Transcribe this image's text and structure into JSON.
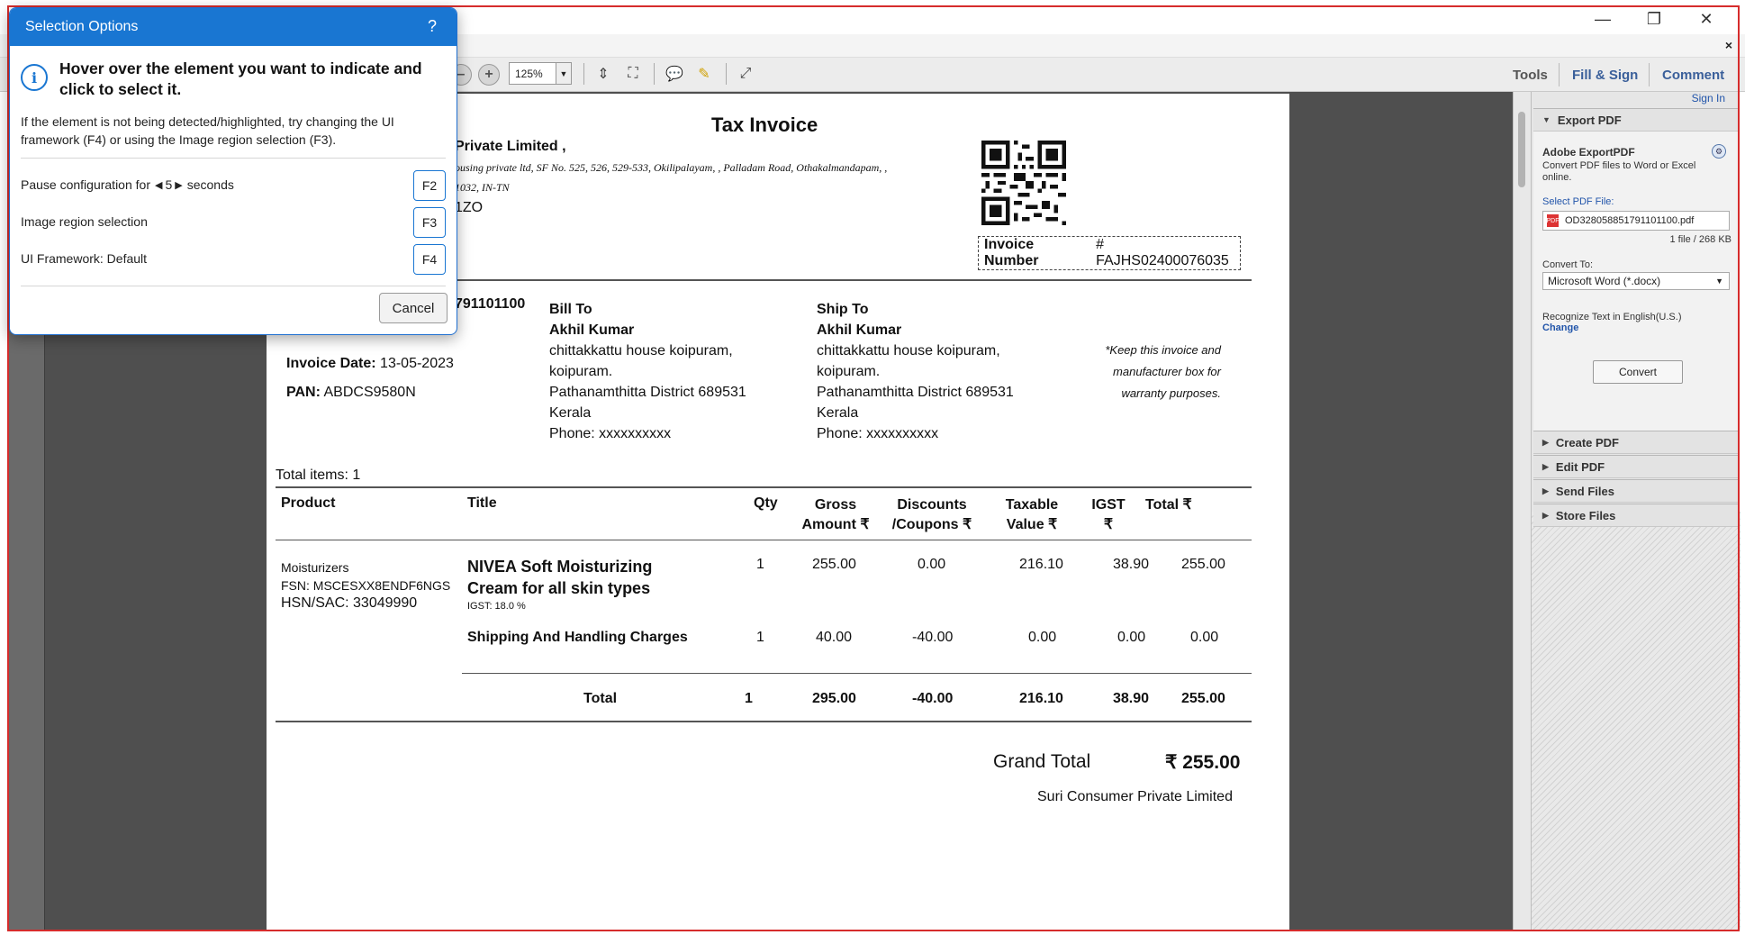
{
  "window": {
    "minimize_glyph": "—",
    "maximize_glyph": "❐",
    "close_glyph": "✕",
    "close_doc_glyph": "×"
  },
  "toolbar": {
    "zoom_value": "125%",
    "tools_label": "Tools",
    "fill_sign_label": "Fill & Sign",
    "comment_label": "Comment"
  },
  "dialog": {
    "title": "Selection Options",
    "help": "?",
    "heading": "Hover over the element you want to indicate and click to select it.",
    "subtext": "If the element is not being detected/highlighted, try changing the UI framework (F4) or using the Image region selection (F3).",
    "pause_prefix": "Pause configuration for",
    "pause_value": "5",
    "pause_suffix": "seconds",
    "pause_key": "F2",
    "image_region_label": "Image region selection",
    "image_region_key": "F3",
    "ui_framework_label": "UI Framework: Default",
    "ui_framework_key": "F4",
    "cancel_label": "Cancel"
  },
  "invoice": {
    "title": "Tax Invoice",
    "seller_name": "Private Limited ,",
    "seller_addr_1": "ousing private ltd, SF No. 525, 526, 529-533, Okilipalayam, , Palladam Road, Othakalmandapam, ,",
    "seller_addr_2": "1032, IN-TN",
    "seller_code": "1ZO",
    "order_id_partial": "791101100",
    "invoice_number_label": "Invoice Number",
    "invoice_number_value": "# FAJHS02400076035",
    "invoice_date_label": "Invoice Date:",
    "invoice_date_value": "13-05-2023",
    "pan_label": "PAN:",
    "pan_value": "ABDCS9580N",
    "bill_to": {
      "heading": "Bill To",
      "name": "Akhil Kumar",
      "line1": "chittakkattu house koipuram,",
      "line2": "koipuram.",
      "line3": "Pathanamthitta District 689531",
      "line4": "Kerala",
      "phone": "Phone: xxxxxxxxxx"
    },
    "ship_to": {
      "heading": "Ship To",
      "name": "Akhil Kumar",
      "line1": "chittakkattu house koipuram,",
      "line2": "koipuram.",
      "line3": "Pathanamthitta District 689531",
      "line4": "Kerala",
      "phone": "Phone: xxxxxxxxxx"
    },
    "note_1": "*Keep this invoice and",
    "note_2": "manufacturer box for",
    "note_3": "warranty purposes.",
    "total_items": "Total items: 1",
    "columns": {
      "product": "Product",
      "title": "Title",
      "qty": "Qty",
      "gross_1": "Gross",
      "gross_2": "Amount ₹",
      "disc_1": "Discounts",
      "disc_2": "/Coupons ₹",
      "taxable_1": "Taxable",
      "taxable_2": "Value ₹",
      "igst_1": "IGST",
      "igst_2": "₹",
      "total": "Total ₹"
    },
    "item": {
      "category": "Moisturizers",
      "fsn": "FSN: MSCESXX8ENDF6NGS",
      "hsn": "HSN/SAC: 33049990",
      "title_1": "NIVEA Soft Moisturizing",
      "title_2": "Cream for all skin types",
      "igst_note": "IGST: 18.0 %",
      "qty": "1",
      "gross": "255.00",
      "discount": "0.00",
      "taxable": "216.10",
      "igst": "38.90",
      "total": "255.00"
    },
    "shipping": {
      "title": "Shipping And Handling Charges",
      "qty": "1",
      "gross": "40.00",
      "discount": "-40.00",
      "taxable": "0.00",
      "igst": "0.00",
      "total": "0.00"
    },
    "totals": {
      "label": "Total",
      "qty": "1",
      "gross": "295.00",
      "discount": "-40.00",
      "taxable": "216.10",
      "igst": "38.90",
      "total": "255.00"
    },
    "grand_total_label": "Grand Total",
    "grand_total_value": "₹ 255.00",
    "signatory": "Suri Consumer Private Limited"
  },
  "right_panel": {
    "sign_in": "Sign In",
    "export_pdf": "Export PDF",
    "adobe_exportpdf": "Adobe ExportPDF",
    "description_1": "Convert PDF files to Word or Excel",
    "description_2": "online.",
    "select_file_label": "Select PDF File:",
    "file_name": "OD328058851791101100.pdf",
    "file_count": "1 file / 268 KB",
    "convert_to_label": "Convert To:",
    "convert_to_value": "Microsoft Word (*.docx)",
    "recognize_text": "Recognize Text in English(U.S.)",
    "change_link": "Change",
    "convert_button": "Convert",
    "create_pdf": "Create PDF",
    "edit_pdf": "Edit PDF",
    "send_files": "Send Files",
    "store_files": "Store Files"
  },
  "colors": {
    "dialog_accent": "#1976d2",
    "highlight_frame": "#d62c2c",
    "link": "#2255aa"
  }
}
